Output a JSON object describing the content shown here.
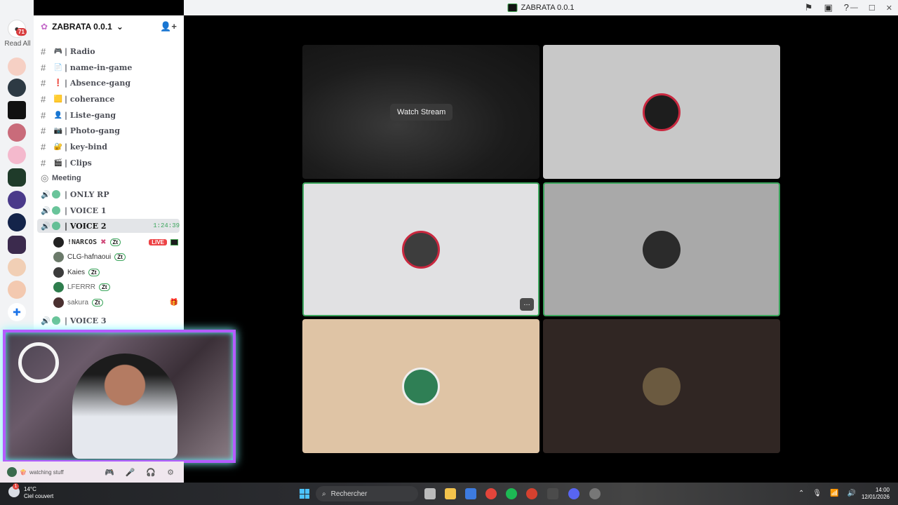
{
  "window": {
    "title": "ZABRATA 0.0.1"
  },
  "rail": {
    "notification_count": "71",
    "read_all_label": "Read All"
  },
  "server": {
    "name": "ZABRATA 0.0.1"
  },
  "channels": [
    {
      "emoji": "🎮",
      "label": "| Radio"
    },
    {
      "emoji": "📄",
      "label": "| name-in-game"
    },
    {
      "emoji": "❗",
      "label": "| Absence-gang"
    },
    {
      "emoji": "🟨",
      "label": "| coherance"
    },
    {
      "emoji": "👤",
      "label": "| Liste-gang"
    },
    {
      "emoji": "📷",
      "label": "| Photo-gang"
    },
    {
      "emoji": "🔐",
      "label": "| key-bind"
    },
    {
      "emoji": "🎬",
      "label": "| Clips"
    }
  ],
  "meeting_label": "Meeting",
  "voice_channels": [
    {
      "label": "| ONLY RP"
    },
    {
      "label": "| VOICE 1"
    },
    {
      "label": "| VOICE 2",
      "time": "1:24:39"
    },
    {
      "label": "| VOICE 3"
    }
  ],
  "voice_users": [
    {
      "name": "!NARCOS",
      "tag": "Zt",
      "live": "LIVE"
    },
    {
      "name": "CLG-hafnaoui",
      "tag": "Zt"
    },
    {
      "name": "Kaies",
      "tag": "Zt"
    },
    {
      "name": "LFERRR",
      "tag": "Zt"
    },
    {
      "name": "sakura",
      "tag": "Zt"
    }
  ],
  "user_panel": {
    "status": "watching stuff"
  },
  "stream": {
    "watch_label": "Watch Stream",
    "more_label": "…"
  },
  "taskbar": {
    "weather_temp": "14°C",
    "weather_desc": "Ciel couvert",
    "weather_badge": "1",
    "search_placeholder": "Rechercher",
    "time": "14:00",
    "date": "12/01/2026"
  }
}
